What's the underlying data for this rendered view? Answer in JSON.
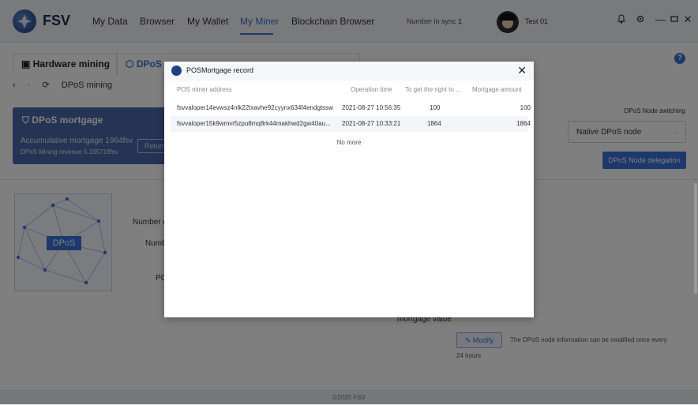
{
  "app": {
    "name": "FSV",
    "nav": [
      "My Data",
      "Browser",
      "My Wallet",
      "My Miner",
      "Blockchain Browser"
    ],
    "active_nav": "My Miner",
    "sync_label": "Number in sync",
    "sync_value": "1",
    "user_name": "Test 01",
    "accent_color": "#3a70d8"
  },
  "page": {
    "tabs": [
      "Hardware mining",
      "DPoS"
    ],
    "breadcrumb": "DPoS mining",
    "mortgage_card": {
      "title": "DPoS mortgage",
      "accumulative": "Accumulative mortgage 1964fsv",
      "revenue": "DPoS Mining revenue 5.195718fsv",
      "return_label": "Return"
    },
    "node_switch_label": "DPoS Node switching",
    "node_select_value": "Native DPoS node",
    "delegation_button": "DPoS Node delegation",
    "dpos_graphic_label": "DPoS",
    "field_labels": [
      "Number o",
      "Numb",
      "PO"
    ],
    "mortgage_value_label": "mortgage value",
    "modify_label": "Modify",
    "modify_note": "The DPoS node information can be modified once every",
    "modify_note2": "24 hours",
    "footer": "©2020 FSV"
  },
  "modal": {
    "title": "POSMortgage record",
    "columns": [
      "POS miner address",
      "Operation time",
      "To get the right to ...",
      "Mortgage amount"
    ],
    "rows": [
      [
        "fsvvaloper14evwsz4nlk22txavhe92cyynx634f4endgtssw",
        "2021-08-27 10:56:35",
        "100",
        "100"
      ],
      [
        "fsvvaloper15k9wmvr5zpu8mq8rk44makhwd2gw40au...",
        "2021-08-27 10:33:21",
        "1864",
        "1864"
      ]
    ],
    "no_more": "No more"
  }
}
